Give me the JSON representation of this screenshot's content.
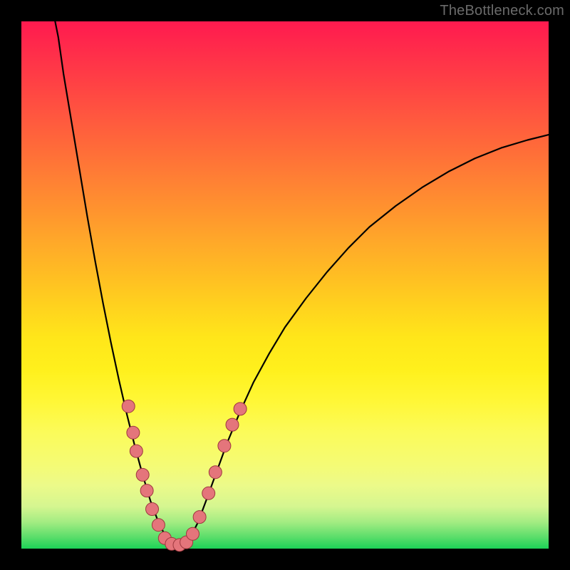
{
  "watermark": "TheBottleneck.com",
  "chart_data": {
    "type": "line",
    "title": "",
    "xlabel": "",
    "ylabel": "",
    "xlim": [
      0,
      100
    ],
    "ylim": [
      0,
      100
    ],
    "grid": false,
    "legend": false,
    "series": [
      {
        "name": "curve",
        "stroke": "#000000",
        "stroke_width": 2.2,
        "points": [
          {
            "x": 6.0,
            "y": 102.0
          },
          {
            "x": 7.0,
            "y": 97.0
          },
          {
            "x": 8.0,
            "y": 90.0
          },
          {
            "x": 9.5,
            "y": 81.0
          },
          {
            "x": 11.0,
            "y": 72.0
          },
          {
            "x": 12.5,
            "y": 63.0
          },
          {
            "x": 14.0,
            "y": 54.5
          },
          {
            "x": 15.5,
            "y": 46.5
          },
          {
            "x": 17.0,
            "y": 39.0
          },
          {
            "x": 18.5,
            "y": 32.0
          },
          {
            "x": 20.0,
            "y": 25.5
          },
          {
            "x": 21.5,
            "y": 19.5
          },
          {
            "x": 23.0,
            "y": 14.0
          },
          {
            "x": 24.5,
            "y": 9.0
          },
          {
            "x": 26.0,
            "y": 5.0
          },
          {
            "x": 27.5,
            "y": 2.0
          },
          {
            "x": 29.0,
            "y": 0.5
          },
          {
            "x": 30.5,
            "y": 0.5
          },
          {
            "x": 32.0,
            "y": 2.0
          },
          {
            "x": 33.5,
            "y": 5.0
          },
          {
            "x": 35.0,
            "y": 9.0
          },
          {
            "x": 37.0,
            "y": 14.5
          },
          {
            "x": 39.0,
            "y": 20.0
          },
          {
            "x": 41.5,
            "y": 26.0
          },
          {
            "x": 44.0,
            "y": 31.5
          },
          {
            "x": 47.0,
            "y": 37.0
          },
          {
            "x": 50.0,
            "y": 42.0
          },
          {
            "x": 54.0,
            "y": 47.5
          },
          {
            "x": 58.0,
            "y": 52.5
          },
          {
            "x": 62.0,
            "y": 57.0
          },
          {
            "x": 66.0,
            "y": 61.0
          },
          {
            "x": 71.0,
            "y": 65.0
          },
          {
            "x": 76.0,
            "y": 68.5
          },
          {
            "x": 81.0,
            "y": 71.5
          },
          {
            "x": 86.0,
            "y": 74.0
          },
          {
            "x": 91.0,
            "y": 76.0
          },
          {
            "x": 96.0,
            "y": 77.5
          },
          {
            "x": 100.0,
            "y": 78.5
          }
        ]
      },
      {
        "name": "dots",
        "type": "scatter",
        "fill": "#e4757b",
        "stroke": "#9d383e",
        "r": 9,
        "points": [
          {
            "x": 20.3,
            "y": 27.0
          },
          {
            "x": 21.2,
            "y": 22.0
          },
          {
            "x": 21.8,
            "y": 18.5
          },
          {
            "x": 23.0,
            "y": 14.0
          },
          {
            "x": 23.8,
            "y": 11.0
          },
          {
            "x": 24.8,
            "y": 7.5
          },
          {
            "x": 26.0,
            "y": 4.5
          },
          {
            "x": 27.2,
            "y": 2.0
          },
          {
            "x": 28.5,
            "y": 0.9
          },
          {
            "x": 30.0,
            "y": 0.7
          },
          {
            "x": 31.3,
            "y": 1.2
          },
          {
            "x": 32.5,
            "y": 2.8
          },
          {
            "x": 33.8,
            "y": 6.0
          },
          {
            "x": 35.5,
            "y": 10.5
          },
          {
            "x": 36.8,
            "y": 14.5
          },
          {
            "x": 38.5,
            "y": 19.5
          },
          {
            "x": 40.0,
            "y": 23.5
          },
          {
            "x": 41.5,
            "y": 26.5
          }
        ]
      }
    ],
    "background_gradient_stops": [
      {
        "pos": 0.0,
        "color": "#ff1a4f"
      },
      {
        "pos": 0.5,
        "color": "#ffc822"
      },
      {
        "pos": 0.8,
        "color": "#f8fb6a"
      },
      {
        "pos": 1.0,
        "color": "#1dd257"
      }
    ]
  }
}
